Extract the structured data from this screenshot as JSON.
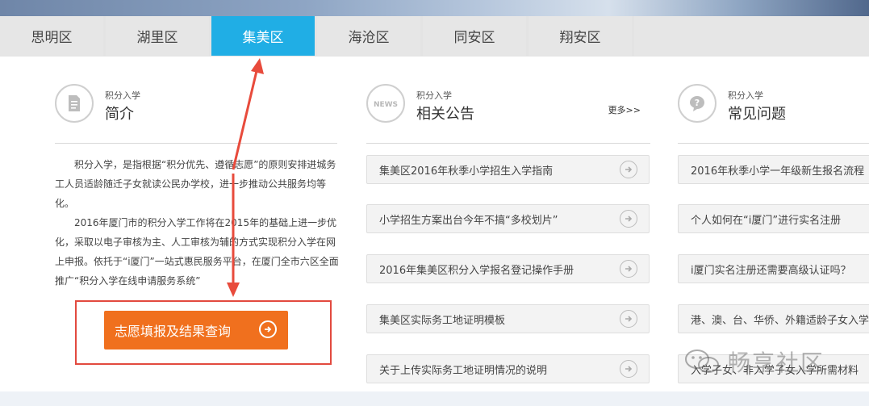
{
  "tabs": [
    "思明区",
    "湖里区",
    "集美区",
    "海沧区",
    "同安区",
    "翔安区"
  ],
  "active_tab": "集美区",
  "intro": {
    "subtitle": "积分入学",
    "title": "简介",
    "paragraphs": [
      "积分入学，是指根据“积分优先、遵循志愿”的原则安排进城务工人员适龄随迁子女就读公民办学校，进一步推动公共服务均等化。",
      "2016年厦门市的积分入学工作将在2015年的基础上进一步优化，采取以电子审核为主、人工审核为辅的方式实现积分入学在网上申报。依托于“i厦门”一站式惠民服务平台，在厦门全市六区全面推广“积分入学在线申请服务系统”"
    ],
    "button_label": "志愿填报及结果查询"
  },
  "news": {
    "subtitle": "积分入学",
    "title": "相关公告",
    "more_label": "更多>>",
    "items": [
      "集美区2016年秋季小学招生入学指南",
      "小学招生方案出台今年不搞“多校划片”",
      "2016年集美区积分入学报名登记操作手册",
      "集美区实际务工地证明模板",
      "关于上传实际务工地证明情况的说明"
    ]
  },
  "faq": {
    "subtitle": "积分入学",
    "title": "常见问题",
    "items": [
      "2016年秋季小学一年级新生报名流程",
      "个人如何在“i厦门”进行实名注册",
      "i厦门实名注册还需要高级认证吗？",
      "港、澳、台、华侨、外籍适龄子女入学",
      "入学子女、非入学子女入学所需材料"
    ]
  },
  "watermark_text": "畅享社区",
  "colors": {
    "active_tab": "#20aee5",
    "button": "#f0701e",
    "highlight_box": "#e24a3f",
    "annotation_arrow": "#e84b3c"
  }
}
